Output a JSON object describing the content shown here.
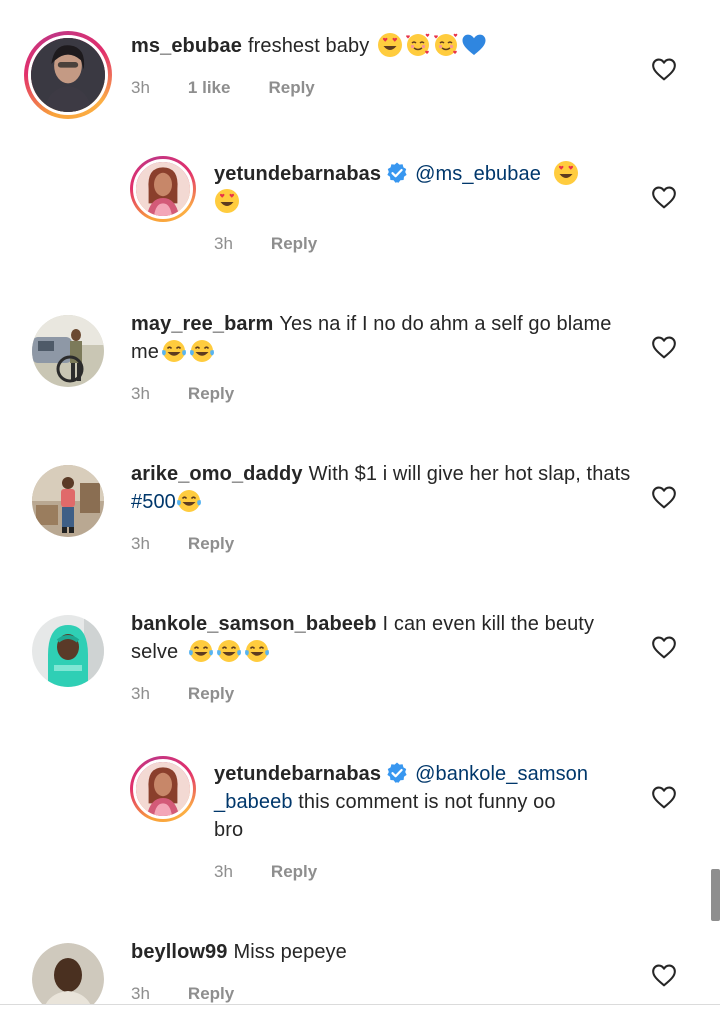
{
  "comments": [
    {
      "username": "ms_ebubae",
      "text": "freshest baby",
      "emojis": [
        "heart-eyes",
        "smiling-hearts",
        "smiling-hearts",
        "blue-heart"
      ],
      "time": "3h",
      "likes": "1 like",
      "reply_label": "Reply"
    },
    {
      "username": "yetundebarnabas",
      "verified": true,
      "mention": "@ms_ebubae",
      "emojis": [
        "heart-eyes",
        "heart-eyes"
      ],
      "time": "3h",
      "reply_label": "Reply"
    },
    {
      "username": "may_ree_barm",
      "text": "Yes na if I no do ahm a self go blame me",
      "emojis": [
        "tears-of-joy",
        "tears-of-joy"
      ],
      "time": "3h",
      "reply_label": "Reply"
    },
    {
      "username": "arike_omo_daddy",
      "text": "With $1 i will give her hot slap, thats",
      "tag": "#500",
      "emojis": [
        "tears-of-joy"
      ],
      "time": "3h",
      "reply_label": "Reply"
    },
    {
      "username": "bankole_samson_babeeb",
      "text": "I can even kill the beuty selve",
      "emojis": [
        "tears-of-joy",
        "tears-of-joy",
        "tears-of-joy"
      ],
      "time": "3h",
      "reply_label": "Reply"
    },
    {
      "username": "yetundebarnabas",
      "verified": true,
      "mention_line1": "@bankole_samson",
      "mention_line2": "_babeeb",
      "text": "this comment is not funny oo",
      "text_line3": "bro",
      "time": "3h",
      "reply_label": "Reply"
    },
    {
      "username": "beyllow99",
      "text": "Miss pepeye",
      "time": "3h",
      "reply_label": "Reply"
    }
  ],
  "colors": {
    "text": "#262626",
    "muted": "#8e8e8e",
    "link": "#00376b",
    "verified": "#3897f0"
  },
  "icons": [
    "heart-outline-icon",
    "verified-badge-icon"
  ]
}
